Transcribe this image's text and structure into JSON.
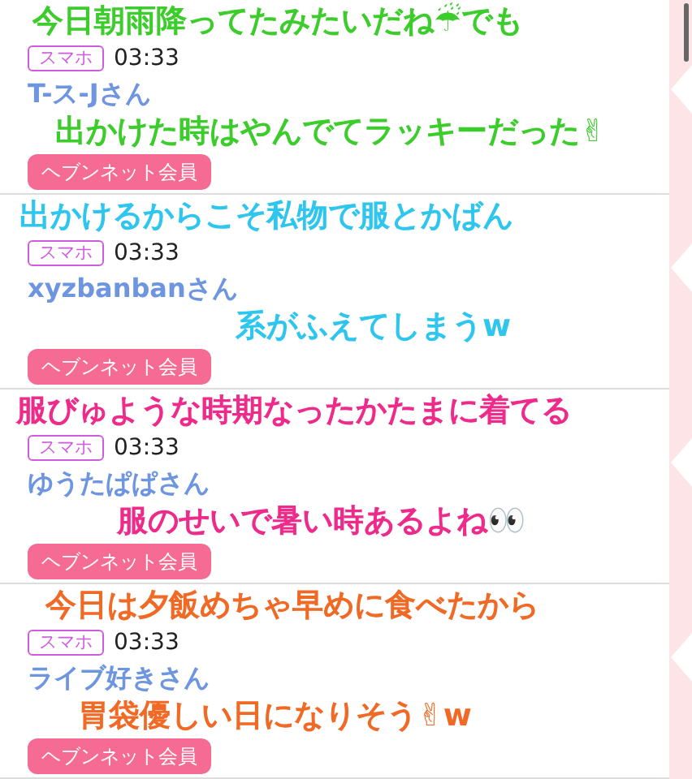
{
  "posts": [
    {
      "device": "スマホ",
      "time": "03:33",
      "user": "T-ス-Jさん",
      "member_button": "ヘブンネット会員",
      "caption_lines": [
        "今日朝雨降ってたみたいだね☔でも",
        "出かけた時はやんでてラッキーだった✌"
      ],
      "color": "#3ccc2c"
    },
    {
      "device": "スマホ",
      "time": "03:33",
      "user": "xyzbanbanさん",
      "member_button": "ヘブンネット会員",
      "caption_lines": [
        "出かけるからこそ私物で服とかばん",
        "系がふえてしまうw"
      ],
      "color": "#2ec6ee"
    },
    {
      "device": "スマホ",
      "time": "03:33",
      "user": "ゆうたぱぱさん",
      "member_button": "ヘブンネット会員",
      "caption_lines": [
        "服びゅような時期なったかたまに着てる",
        "服のせいで暑い時あるよね👀"
      ],
      "color": "#ee2a8a"
    },
    {
      "device": "スマホ",
      "time": "03:33",
      "user": "ライブ好きさん",
      "member_button": "ヘブンネット会員",
      "caption_lines": [
        "今日は夕飯めちゃ早めに食べたから",
        "胃袋優しい日になりそう✌w"
      ],
      "color": "#f06a26"
    }
  ]
}
